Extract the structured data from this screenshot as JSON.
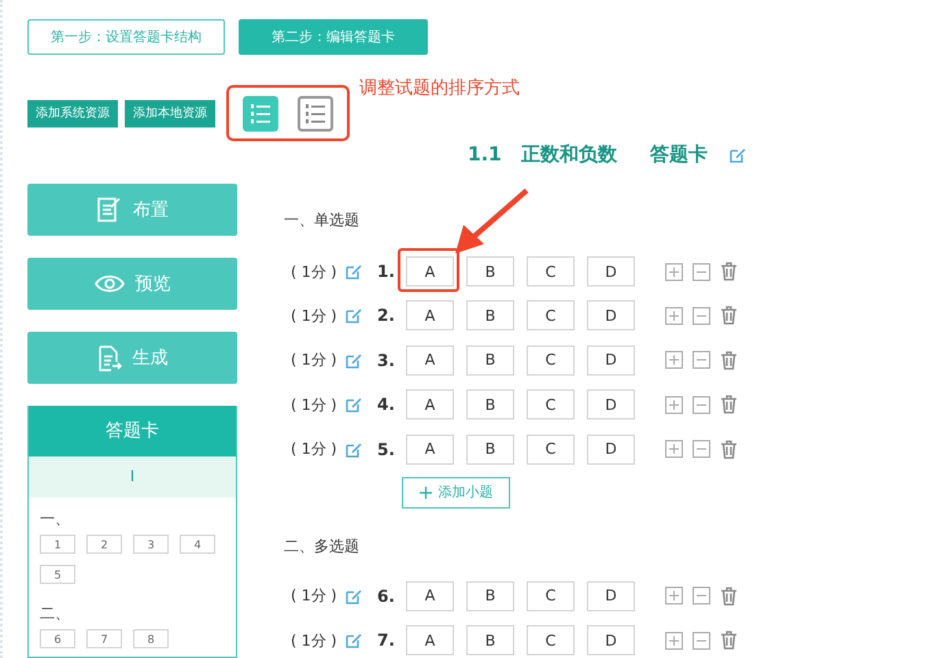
{
  "steps": [
    {
      "label": "第一步：设置答题卡结构",
      "selected": false
    },
    {
      "label": "第二步：编辑答题卡",
      "selected": true
    }
  ],
  "resource_buttons": [
    "添加系统资源",
    "添加本地资源"
  ],
  "sort_modes": [
    {
      "kind": "numbered",
      "selected": true
    },
    {
      "kind": "numbered",
      "selected": false
    }
  ],
  "annotation": {
    "text": "调整试题的排序方式"
  },
  "title": {
    "number": "1.1",
    "name": "正数和负数",
    "suffix": "答题卡"
  },
  "actions": [
    {
      "kind": "layout",
      "label": "布置"
    },
    {
      "kind": "preview",
      "label": "预览"
    },
    {
      "kind": "generate",
      "label": "生成"
    }
  ],
  "card_nav": {
    "title": "答题卡",
    "part": "I",
    "groups": [
      {
        "label": "一、",
        "numbers": [
          "1",
          "2",
          "3",
          "4",
          "5"
        ]
      },
      {
        "label": "二、",
        "numbers": [
          "6",
          "7",
          "8"
        ]
      }
    ]
  },
  "sections": [
    {
      "title": "一、单选题",
      "rows": [
        {
          "score": "( 1分 )",
          "number": "1.",
          "options": [
            "A",
            "B",
            "C",
            "D"
          ],
          "highlighted": true
        },
        {
          "score": "( 1分 )",
          "number": "2.",
          "options": [
            "A",
            "B",
            "C",
            "D"
          ],
          "highlighted": false
        },
        {
          "score": "( 1分 )",
          "number": "3.",
          "options": [
            "A",
            "B",
            "C",
            "D"
          ],
          "highlighted": false
        },
        {
          "score": "( 1分 )",
          "number": "4.",
          "options": [
            "A",
            "B",
            "C",
            "D"
          ],
          "highlighted": false
        },
        {
          "score": "( 1分 )",
          "number": "5.",
          "options": [
            "A",
            "B",
            "C",
            "D"
          ],
          "highlighted": false
        }
      ],
      "add_button": "添加小题"
    },
    {
      "title": "二、多选题",
      "rows": [
        {
          "score": "( 1分 )",
          "number": "6.",
          "options": [
            "A",
            "B",
            "C",
            "D"
          ],
          "highlighted": false
        },
        {
          "score": "( 1分 )",
          "number": "7.",
          "options": [
            "A",
            "B",
            "C",
            "D"
          ],
          "highlighted": false
        }
      ]
    }
  ]
}
